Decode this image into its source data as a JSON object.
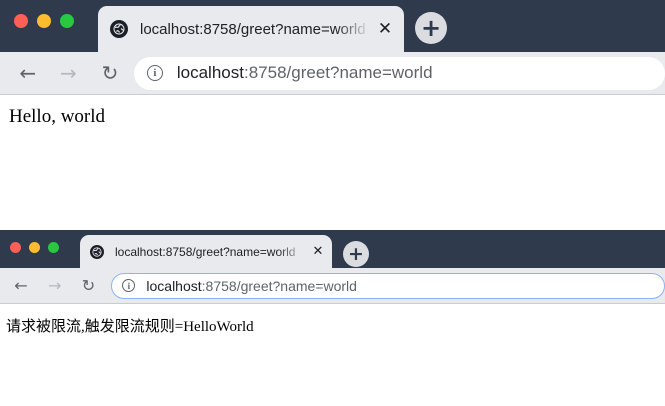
{
  "windows": [
    {
      "tab": {
        "title": "localhost:8758/greet?name=world",
        "close_label": "✕",
        "icon": "globe-icon"
      },
      "new_tab_label": "+",
      "nav": {
        "back": "←",
        "forward": "→",
        "reload": "↻"
      },
      "address_bar": {
        "host": "localhost",
        "rest": ":8758/greet?name=world",
        "info": "i"
      },
      "page": {
        "text": "Hello, world"
      }
    },
    {
      "tab": {
        "title": "localhost:8758/greet?name=world",
        "close_label": "✕",
        "icon": "globe-icon"
      },
      "new_tab_label": "+",
      "nav": {
        "back": "←",
        "forward": "→",
        "reload": "↻"
      },
      "address_bar": {
        "host": "localhost",
        "rest": ":8758/greet?name=world",
        "info": "i"
      },
      "page": {
        "text": "请求被限流,触发限流规则=HelloWorld"
      }
    }
  ],
  "colors": {
    "titlebar": "#2f3a4d",
    "tab": "#e8eaed",
    "toolbar": "#e8eaed",
    "close_dot": "#ff5f57",
    "minimize_dot": "#febc2e",
    "zoom_dot": "#28c840"
  }
}
